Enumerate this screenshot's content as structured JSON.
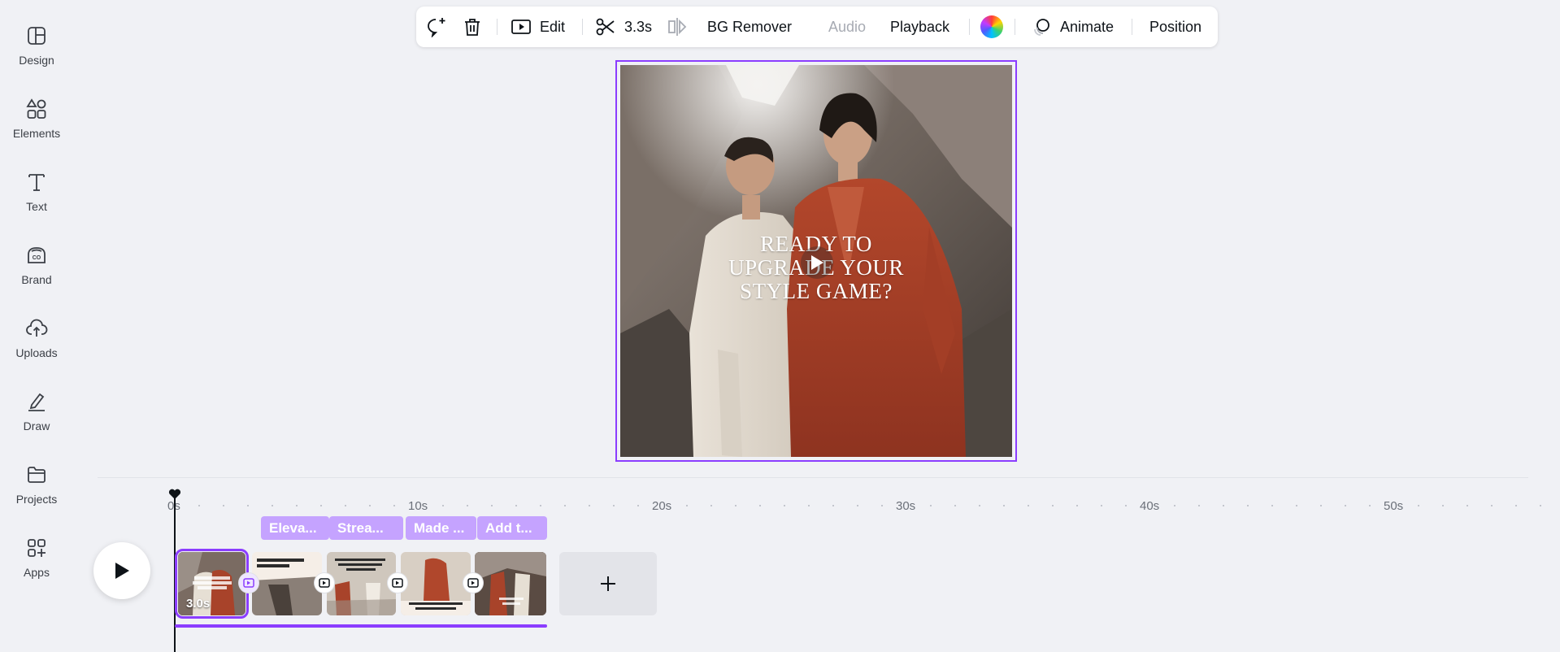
{
  "sidebar": {
    "items": [
      {
        "label": "Design",
        "icon": "design-icon"
      },
      {
        "label": "Elements",
        "icon": "elements-icon"
      },
      {
        "label": "Text",
        "icon": "text-icon"
      },
      {
        "label": "Brand",
        "icon": "brand-icon"
      },
      {
        "label": "Uploads",
        "icon": "uploads-icon"
      },
      {
        "label": "Draw",
        "icon": "draw-icon"
      },
      {
        "label": "Projects",
        "icon": "projects-icon"
      },
      {
        "label": "Apps",
        "icon": "apps-icon"
      }
    ]
  },
  "toolbar": {
    "comment_icon": "add-comment-icon",
    "delete_icon": "trash-icon",
    "edit_label": "Edit",
    "duration_label": "3.3s",
    "flip_icon": "flip-icon",
    "bg_remover_label": "BG Remover",
    "audio_label": "Audio",
    "playback_label": "Playback",
    "color_icon": "color-wheel-icon",
    "animate_label": "Animate",
    "position_label": "Position"
  },
  "canvas": {
    "headline_lines": [
      "READY TO",
      "UPGRADE YOUR",
      "STYLE GAME?"
    ]
  },
  "timeline": {
    "ruler_labels": [
      "0s",
      "10s",
      "20s",
      "30s",
      "40s",
      "50s"
    ],
    "captions": [
      "Eleva...",
      "Strea...",
      "Made ...",
      "Add t..."
    ],
    "clips": [
      {
        "duration": "3.0s",
        "selected": true
      },
      {
        "duration": ""
      },
      {
        "duration": ""
      },
      {
        "duration": ""
      },
      {
        "duration": ""
      }
    ],
    "add_icon": "plus-icon",
    "play_icon": "play-icon"
  },
  "colors": {
    "accent": "#8b3dff",
    "caption_pill": "#c5a3ff",
    "background": "#f0f1f5"
  }
}
